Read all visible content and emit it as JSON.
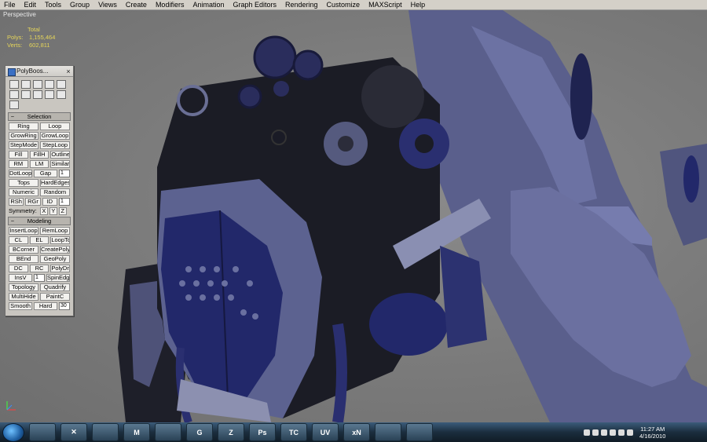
{
  "menu": [
    "File",
    "Edit",
    "Tools",
    "Group",
    "Views",
    "Create",
    "Modifiers",
    "Animation",
    "Graph Editors",
    "Rendering",
    "Customize",
    "MAXScript",
    "Help"
  ],
  "viewport": {
    "label": "Perspective",
    "stats": {
      "header": "Total",
      "polys_label": "Polys:",
      "polys_value": "1,155,464",
      "verts_label": "Verts:",
      "verts_value": "602,811"
    }
  },
  "polyboost": {
    "title": "PolyBoos...",
    "close": "×",
    "tools": [
      "select-icon",
      "view-icon",
      "grid-icon",
      "plus-icon",
      "brush-icon",
      "nav-left-icon",
      "sphere-icon",
      "shade-icon",
      "hash-icon",
      "text-icon",
      "nav-right-icon"
    ],
    "selection": {
      "header": "Selection",
      "rows": [
        [
          "Ring",
          "Loop"
        ],
        [
          "GrowRing",
          "GrowLoop"
        ],
        [
          "StepMode",
          "StepLoop"
        ],
        [
          "Fill",
          "FillH",
          "Outline"
        ],
        [
          "RM",
          "LM",
          "Similar"
        ],
        [
          "DotLoop",
          "Gap",
          "1"
        ],
        [
          "Tops",
          "HardEdges"
        ],
        [
          "Numeric",
          "Random"
        ],
        [
          "RSh",
          "RGr",
          "ID",
          "1"
        ],
        [
          "Symmetry:",
          "X",
          "Y",
          "Z"
        ]
      ]
    },
    "modeling": {
      "header": "Modeling",
      "rows": [
        [
          "InsertLoop",
          "RemLoop"
        ],
        [
          "CL",
          "EL",
          "LoopTools"
        ],
        [
          "BCorner",
          "CreatePoly"
        ],
        [
          "BEnd",
          "GeoPoly"
        ],
        [
          "DC",
          "RC",
          "PolyDraw"
        ],
        [
          "InsV",
          "1",
          "SpinEdge"
        ],
        [
          "Topology",
          "Quadrify"
        ],
        [
          "MultiHide",
          "PaintC"
        ],
        [
          "Smooth",
          "Hard",
          "30"
        ]
      ]
    }
  },
  "taskbar": {
    "apps": [
      {
        "name": "explorer",
        "text": ""
      },
      {
        "name": "xmind",
        "text": "✕"
      },
      {
        "name": "firefox",
        "text": ""
      },
      {
        "name": "gmail",
        "text": "M"
      },
      {
        "name": "app-hand",
        "text": ""
      },
      {
        "name": "app-g",
        "text": "G"
      },
      {
        "name": "zbrush",
        "text": "Z"
      },
      {
        "name": "photoshop",
        "text": "Ps"
      },
      {
        "name": "app-tc",
        "text": "TC"
      },
      {
        "name": "uvlayout",
        "text": "UV"
      },
      {
        "name": "xnormal",
        "text": "xN"
      },
      {
        "name": "app-bird",
        "text": ""
      },
      {
        "name": "app-splat",
        "text": ""
      }
    ],
    "time": "11:27 AM",
    "date": "4/16/2010"
  },
  "colors": {
    "armor": "#5c6290",
    "dark": "#1c1d26",
    "navy": "#22286a",
    "viewport": "#7a7a7a",
    "stats": "#e5d55a"
  }
}
